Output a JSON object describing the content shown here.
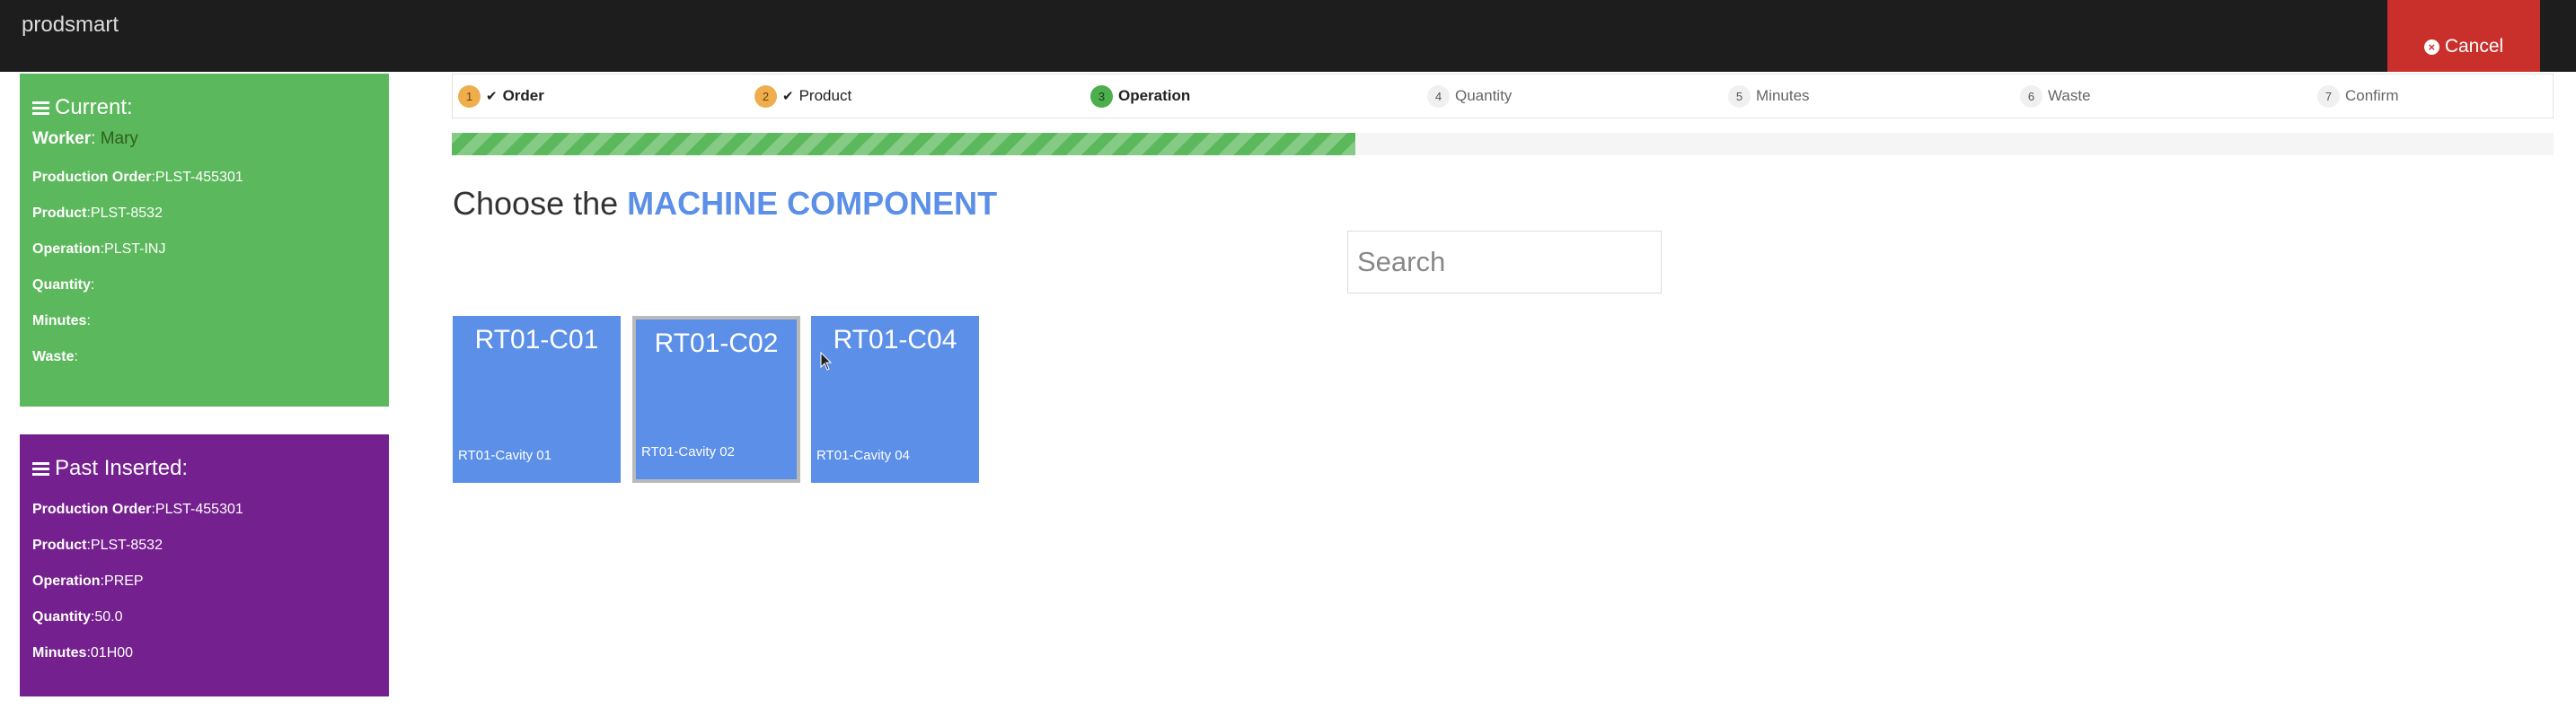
{
  "app": {
    "brand": "prodsmart",
    "cancel_label": "Cancel"
  },
  "current": {
    "title": "Current:",
    "worker_label": "Worker",
    "worker_value": "Mary",
    "rows": [
      {
        "label": "Production Order",
        "value": "PLST-455301"
      },
      {
        "label": "Product",
        "value": "PLST-8532"
      },
      {
        "label": "Operation",
        "value": "PLST-INJ"
      },
      {
        "label": "Quantity",
        "value": ""
      },
      {
        "label": "Minutes",
        "value": ""
      },
      {
        "label": "Waste",
        "value": ""
      }
    ]
  },
  "past": {
    "title": "Past Inserted:",
    "rows": [
      {
        "label": "Production Order",
        "value": "PLST-455301"
      },
      {
        "label": "Product",
        "value": "PLST-8532"
      },
      {
        "label": "Operation",
        "value": "PREP"
      },
      {
        "label": "Quantity",
        "value": "50.0"
      },
      {
        "label": "Minutes",
        "value": "01H00"
      }
    ]
  },
  "steps": [
    {
      "num": "1",
      "label": "Order",
      "state": "done"
    },
    {
      "num": "2",
      "label": "Product",
      "state": "done"
    },
    {
      "num": "3",
      "label": "Operation",
      "state": "active"
    },
    {
      "num": "4",
      "label": "Quantity",
      "state": "todo"
    },
    {
      "num": "5",
      "label": "Minutes",
      "state": "todo"
    },
    {
      "num": "6",
      "label": "Waste",
      "state": "todo"
    },
    {
      "num": "7",
      "label": "Confirm",
      "state": "todo"
    }
  ],
  "progress": {
    "fraction": 0.43
  },
  "heading": {
    "prefix": "Choose the ",
    "strong": "MACHINE COMPONENT"
  },
  "search": {
    "placeholder": "Search"
  },
  "components": [
    {
      "code": "RT01-C01",
      "description": "RT01-Cavity 01",
      "selected": false
    },
    {
      "code": "RT01-C02",
      "description": "RT01-Cavity 02",
      "selected": true
    },
    {
      "code": "RT01-C04",
      "description": "RT01-Cavity 04",
      "selected": false
    }
  ],
  "colors": {
    "current_panel": "#5cb85c",
    "past_panel": "#74208f",
    "accent_blue": "#5b8fe8",
    "cancel_red": "#c9302c",
    "step_done": "#f0ad4e",
    "step_active": "#4cae4c"
  }
}
